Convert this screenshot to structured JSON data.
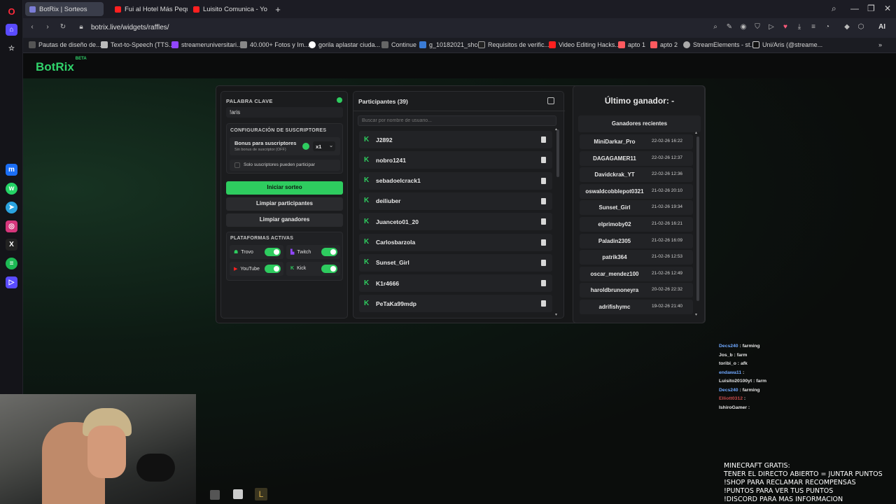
{
  "browser": {
    "tabs": [
      {
        "label": "BotRix | Sorteos",
        "active": true
      },
      {
        "label": "Fui al Hotel Más Pequeño",
        "active": false
      },
      {
        "label": "Luisito Comunica - YouTu",
        "active": false
      }
    ],
    "new_tab": "+",
    "url": "botrix.live/widgets/raffles/",
    "bookmarks": [
      "Pautas de diseño de...",
      "Text-to-Speech (TTS...",
      "streameruniversitari...",
      "40.000+ Fotos y Im...",
      "gorila aplastar ciuda...",
      "Continue",
      "g_10182021_shcc",
      "Requisitos de verific...",
      "Video Editing Hacks...",
      "apto 1",
      "apto 2",
      "StreamElements - st...",
      "Uni/Aris (@streame..."
    ],
    "ai_label": "AI"
  },
  "app": {
    "logo": "BotRix",
    "logo_badge": "BETA"
  },
  "settings": {
    "keyword_label": "PALABRA CLAVE",
    "keyword_value": "!aris",
    "subs_title": "CONFIGURACIÓN DE SUSCRIPTORES",
    "bonus_title": "Bonus para suscriptores",
    "bonus_sub": "Sin bonus de suscriptor (OFF)",
    "multiplier": "x1",
    "subs_only": "Solo suscriptores pueden participar",
    "start_button": "Iniciar sorteo",
    "clear_participants": "Limpiar participantes",
    "clear_winners": "Limpiar ganadores",
    "platforms_title": "PLATAFORMAS ACTIVAS",
    "platforms": [
      {
        "name": "Trovo",
        "enabled": true
      },
      {
        "name": "Twitch",
        "enabled": true
      },
      {
        "name": "YouTube",
        "enabled": true
      },
      {
        "name": "Kick",
        "enabled": true
      }
    ]
  },
  "participants": {
    "title": "Participantes (39)",
    "search_placeholder": "Buscar por nombre de usuario...",
    "list": [
      "J2892",
      "nobro1241",
      "sebadoelcrack1",
      "deiliuber",
      "Juanceto01_20",
      "Carlosbarzola",
      "Sunset_Girl",
      "K1r4666",
      "PeTaKa99mdp"
    ]
  },
  "winners": {
    "last_winner": "Último ganador: -",
    "recent_title": "Ganadores recientes",
    "list": [
      {
        "name": "MiniDarkar_Pro",
        "date": "22-02-26 16:22"
      },
      {
        "name": "DAGAGAMER11",
        "date": "22-02-26 12:37"
      },
      {
        "name": "Davidckrak_YT",
        "date": "22-02-26 12:36"
      },
      {
        "name": "oswaldcobblepot0321",
        "date": "21-02-26 20:10"
      },
      {
        "name": "Sunset_Girl",
        "date": "21-02-26 19:34"
      },
      {
        "name": "elprimoby02",
        "date": "21-02-26 16:21"
      },
      {
        "name": "Paladin2305",
        "date": "21-02-26 16:09"
      },
      {
        "name": "patrik364",
        "date": "21-02-26 12:53"
      },
      {
        "name": "oscar_mendez100",
        "date": "21-02-26 12:49"
      },
      {
        "name": "haroldbrunoneyra",
        "date": "20-02-26 22:32"
      },
      {
        "name": "adrifishymc",
        "date": "19-02-26 21:40"
      }
    ]
  },
  "chat": [
    {
      "user": "Decs240",
      "msg": " : farming",
      "color": "#6fa8ff"
    },
    {
      "user": "Jos_b",
      "msg": " : farm",
      "color": "#e6e6e6"
    },
    {
      "user": "toribi_o",
      "msg": " : afk",
      "color": "#e6e6e6"
    },
    {
      "user": "endawa11",
      "msg": " : ",
      "color": "#6fa8ff"
    },
    {
      "user": "Luisito20100yt",
      "msg": " : farm",
      "color": "#e6e6e6"
    },
    {
      "user": "Decs240",
      "msg": " : farming",
      "color": "#6fa8ff"
    },
    {
      "user": "Elliott0312",
      "msg": " : ",
      "color": "#c94a4a"
    },
    {
      "user": "IshiroGamer",
      "msg": " : ",
      "color": "#e6e6e6"
    }
  ],
  "overlay_text": "MINECRAFT GRATIS:\nTENER EL DIRECTO ABIERTO = JUNTAR PUNTOS\n!SHOP PARA RECLAMAR RECOMPENSAS\n!PUNTOS PARA VER TUS PUNTOS\n!DISCORD PARA MAS INFORMACION",
  "colors": {
    "accent": "#2ecc5f",
    "panel": "#1b1c1e"
  }
}
